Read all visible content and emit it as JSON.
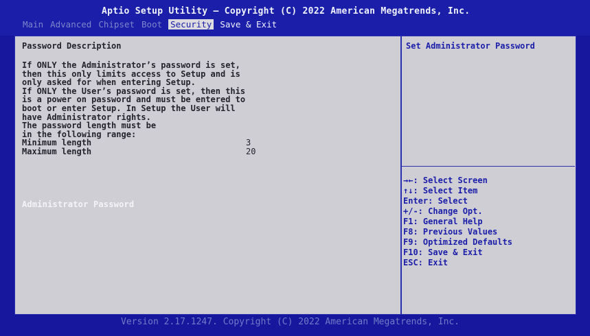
{
  "header": {
    "title": "Aptio Setup Utility – Copyright (C) 2022 American Megatrends, Inc.",
    "tabs": [
      {
        "label": "Main"
      },
      {
        "label": "Advanced"
      },
      {
        "label": "Chipset"
      },
      {
        "label": "Boot"
      },
      {
        "label": "Security",
        "active": true
      },
      {
        "label": "Save & Exit"
      }
    ]
  },
  "main": {
    "heading": "Password Description",
    "lines": [
      "If ONLY the Administrator’s password is set,",
      "then this only limits access to Setup and is",
      "only asked for when entering Setup.",
      "If ONLY the User’s password is set, then this",
      "is a power on password and must be entered to",
      "boot or enter Setup. In Setup the User will",
      "have Administrator rights.",
      "The password length must be",
      "in the following range:"
    ],
    "min_label": "Minimum length",
    "min_value": "3",
    "max_label": "Maximum length",
    "max_value": "20",
    "admin_password": "Administrator Password"
  },
  "help": {
    "title": "Set Administrator Password",
    "keys": [
      "→←: Select Screen",
      "↑↓: Select Item",
      "Enter: Select",
      "+/-: Change Opt.",
      "F1: General Help",
      "F8: Previous Values",
      "F9: Optimized Defaults",
      "F10: Save & Exit",
      "ESC: Exit"
    ]
  },
  "footer": {
    "version": "Version 2.17.1247. Copyright (C) 2022 American Megatrends, Inc."
  },
  "colors": {
    "background": "#16179c",
    "panel": "#cfced5",
    "highlight_text": "#1a1ea8",
    "selected_item_text": "#f4f4f6"
  }
}
